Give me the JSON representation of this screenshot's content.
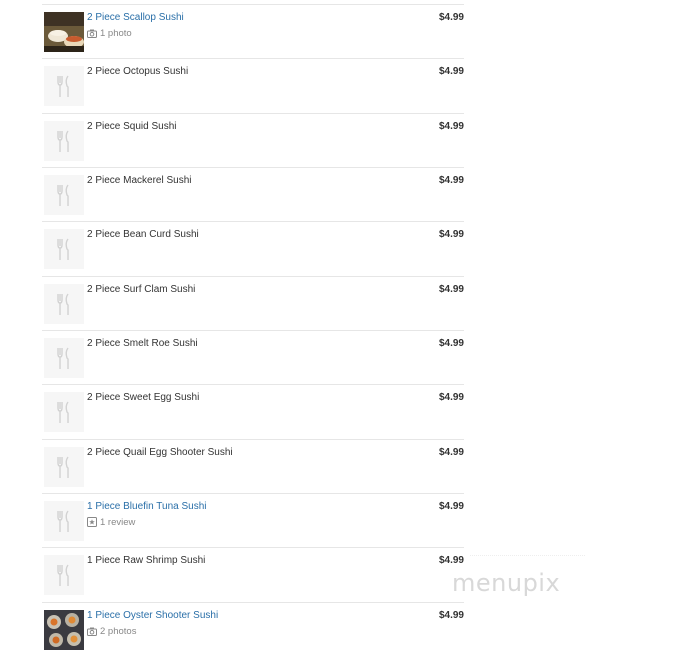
{
  "menu": {
    "items": [
      {
        "name": "2 Piece Scallop Sushi",
        "price": "$4.99",
        "meta": "1 photo",
        "meta_icon": "camera-icon",
        "link": true,
        "thumb": "scallop-photo"
      },
      {
        "name": "2 Piece Octopus Sushi",
        "price": "$4.99",
        "link": false,
        "thumb": "utensils-placeholder"
      },
      {
        "name": "2 Piece Squid Sushi",
        "price": "$4.99",
        "link": false,
        "thumb": "utensils-placeholder"
      },
      {
        "name": "2 Piece Mackerel Sushi",
        "price": "$4.99",
        "link": false,
        "thumb": "utensils-placeholder"
      },
      {
        "name": "2 Piece Bean Curd Sushi",
        "price": "$4.99",
        "link": false,
        "thumb": "utensils-placeholder"
      },
      {
        "name": "2 Piece Surf Clam Sushi",
        "price": "$4.99",
        "link": false,
        "thumb": "utensils-placeholder"
      },
      {
        "name": "2 Piece Smelt Roe Sushi",
        "price": "$4.99",
        "link": false,
        "thumb": "utensils-placeholder"
      },
      {
        "name": "2 Piece Sweet Egg Sushi",
        "price": "$4.99",
        "link": false,
        "thumb": "utensils-placeholder"
      },
      {
        "name": "2 Piece Quail Egg Shooter Sushi",
        "price": "$4.99",
        "link": false,
        "thumb": "utensils-placeholder"
      },
      {
        "name": "1 Piece Bluefin Tuna Sushi",
        "price": "$4.99",
        "meta": "1 review",
        "meta_icon": "review-icon",
        "link": true,
        "thumb": "utensils-placeholder"
      },
      {
        "name": "1 Piece Raw Shrimp Sushi",
        "price": "$4.99",
        "link": false,
        "thumb": "utensils-placeholder"
      },
      {
        "name": "1 Piece Oyster Shooter Sushi",
        "price": "$4.99",
        "meta": "2 photos",
        "meta_icon": "camera-icon",
        "link": true,
        "thumb": "oyster-photo"
      }
    ]
  },
  "watermark": {
    "text": "menupix"
  },
  "colors": {
    "link": "#2a6fa8",
    "text": "#333333",
    "muted": "#888888",
    "divider": "#e6e6e6",
    "placeholder_bg": "#f6f6f6"
  }
}
